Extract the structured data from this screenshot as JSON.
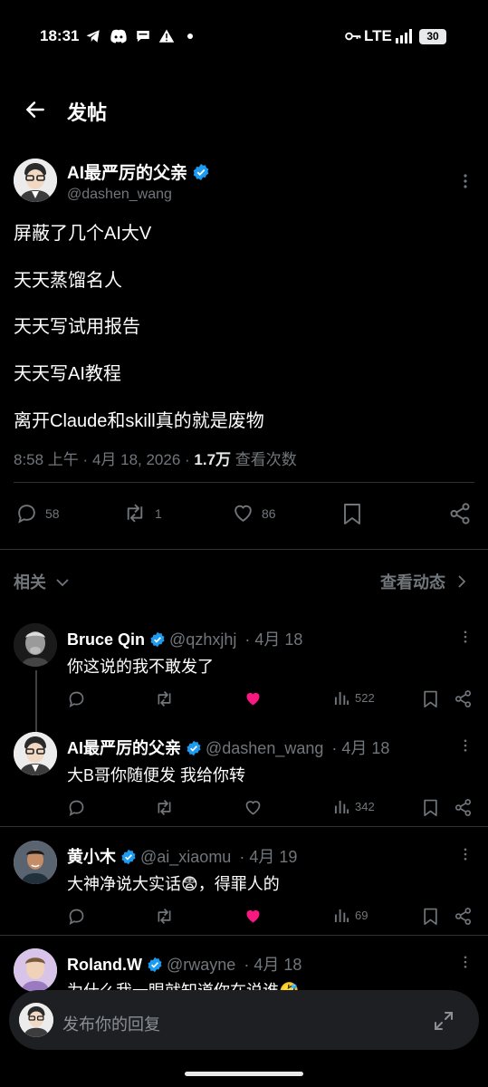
{
  "status_bar": {
    "time": "18:31",
    "network": "LTE",
    "battery": "30"
  },
  "header": {
    "title": "发帖"
  },
  "main_post": {
    "author": "AI最严厉的父亲",
    "handle": "@dashen_wang",
    "lines": [
      "屏蔽了几个AI大V",
      "天天蒸馏名人",
      "天天写试用报告",
      "天天写AI教程",
      "离开Claude和skill真的就是废物"
    ],
    "time": "8:58 上午",
    "date": "4月 18, 2026",
    "views_count": "1.7万",
    "views_label": "查看次数",
    "replies": "58",
    "reposts": "1",
    "likes": "86"
  },
  "related": {
    "label": "相关",
    "view_activity": "查看动态"
  },
  "replies": [
    {
      "name": "Bruce Qin",
      "handle": "@qzhxjhj",
      "date": "4月 18",
      "text": "你这说的我不敢发了",
      "views": "522",
      "liked": true
    },
    {
      "name": "AI最严厉的父亲",
      "handle": "@dashen_wang",
      "date": "4月 18",
      "text": "大B哥你随便发 我给你转",
      "views": "342",
      "liked": false
    },
    {
      "name": "黄小木",
      "handle": "@ai_xiaomu",
      "date": "4月 19",
      "text": "大神净说大实话😨，得罪人的",
      "views": "69",
      "liked": true
    },
    {
      "name": "Roland.W",
      "handle": "@rwayne",
      "date": "4月 18",
      "text": "为什么我一眼就知道你在说谁🤣"
    }
  ],
  "reply_box": {
    "placeholder": "发布你的回复"
  },
  "colors": {
    "background": "#000000",
    "verified": "#1d9bf0",
    "like_active": "#f91880",
    "muted": "#71767b"
  }
}
